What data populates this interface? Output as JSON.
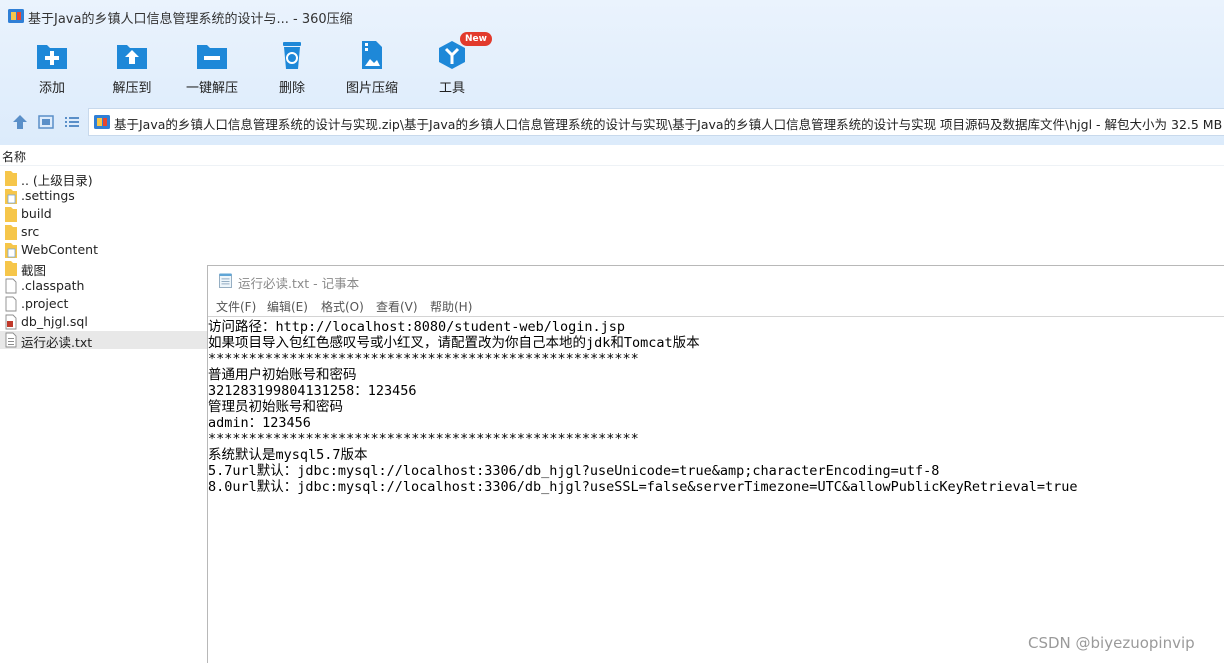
{
  "window": {
    "title": "基于Java的乡镇人口信息管理系统的设计与... - 360压缩"
  },
  "toolbar": {
    "buttons": [
      {
        "label": "添加",
        "icon": "add-icon"
      },
      {
        "label": "解压到",
        "icon": "extract-to-icon"
      },
      {
        "label": "一键解压",
        "icon": "one-click-extract-icon"
      },
      {
        "label": "删除",
        "icon": "delete-icon"
      },
      {
        "label": "图片压缩",
        "icon": "image-compress-icon"
      },
      {
        "label": "工具",
        "icon": "tools-icon",
        "badge": "New"
      }
    ]
  },
  "pathbar": {
    "path": "基于Java的乡镇人口信息管理系统的设计与实现.zip\\基于Java的乡镇人口信息管理系统的设计与实现\\基于Java的乡镇人口信息管理系统的设计与实现 项目源码及数据库文件\\hjgl - 解包大小为 32.5 MB"
  },
  "file_list": {
    "column_name": "名称",
    "items": [
      {
        "name": ".. (上级目录)",
        "type": "folder"
      },
      {
        "name": ".settings",
        "type": "folder-file"
      },
      {
        "name": "build",
        "type": "folder"
      },
      {
        "name": "src",
        "type": "folder"
      },
      {
        "name": "WebContent",
        "type": "folder-file"
      },
      {
        "name": "截图",
        "type": "folder"
      },
      {
        "name": ".classpath",
        "type": "file"
      },
      {
        "name": ".project",
        "type": "file"
      },
      {
        "name": "db_hjgl.sql",
        "type": "sql"
      },
      {
        "name": "运行必读.txt",
        "type": "txt",
        "selected": true
      }
    ]
  },
  "notepad": {
    "title": "运行必读.txt - 记事本",
    "menu": [
      "文件(F)",
      "编辑(E)",
      "格式(O)",
      "查看(V)",
      "帮助(H)"
    ],
    "lines": [
      "访问路径：http://localhost:8080/student-web/login.jsp",
      "如果项目导入包红色感叹号或小红叉，请配置改为你自己本地的jdk和Tomcat版本",
      "*****************************************************",
      "普通用户初始账号和密码",
      "321283199804131258：123456",
      "管理员初始账号和密码",
      "admin：123456",
      "*****************************************************",
      "系统默认是mysql5.7版本",
      "5.7url默认：jdbc:mysql://localhost:3306/db_hjgl?useUnicode=true&amp;characterEncoding=utf-8",
      "8.0url默认：jdbc:mysql://localhost:3306/db_hjgl?useSSL=false&serverTimezone=UTC&allowPublicKeyRetrieval=true"
    ]
  },
  "watermark": "CSDN @biyezuopinvip",
  "colors": {
    "accent_blue": "#1e88d8",
    "badge_red": "#e23a2c",
    "folder_yellow": "#f6c64a"
  }
}
